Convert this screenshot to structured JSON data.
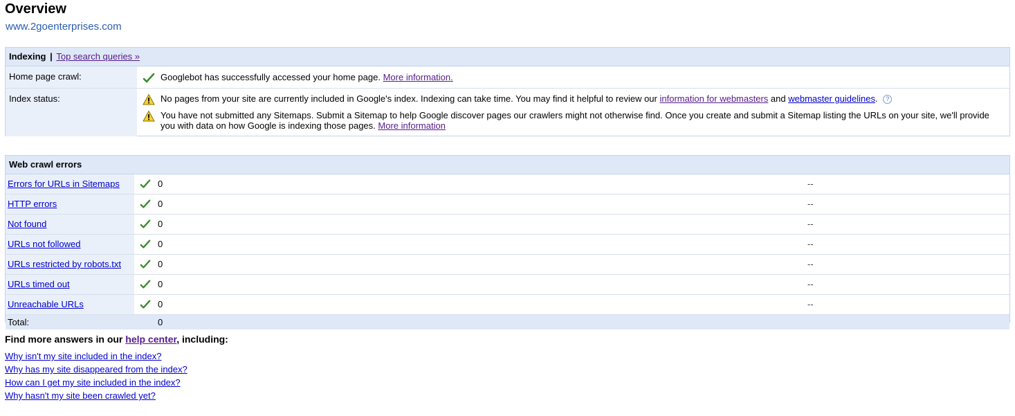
{
  "page": {
    "title": "Overview",
    "site_url": "www.2goenterprises.com"
  },
  "indexing": {
    "header_label": "Indexing",
    "header_separator": "|",
    "top_queries_link": "Top search queries »",
    "home_crawl": {
      "label": "Home page crawl:",
      "message": "Googlebot has successfully accessed your home page.",
      "link": "More information."
    },
    "index_status": {
      "label": "Index status:",
      "msg1_text": "No pages from your site are currently included in Google's index. Indexing can take time. You may find it helpful to review our",
      "msg1_link1": "information for webmasters",
      "msg1_and": "and",
      "msg1_link2": "webmaster guidelines",
      "msg1_period": ".",
      "help_glyph": "?",
      "msg2_text": "You have not submitted any Sitemaps. Submit a Sitemap to help Google discover pages our crawlers might not otherwise find. Once you create and submit a Sitemap listing the URLs on your site, we'll provide you with data on how Google is indexing those pages.",
      "msg2_link": "More information"
    }
  },
  "crawl_errors": {
    "header": "Web crawl errors",
    "rows": [
      {
        "label": "Errors for URLs in Sitemaps",
        "count": "0",
        "detail": "--"
      },
      {
        "label": "HTTP errors",
        "count": "0",
        "detail": "--"
      },
      {
        "label": "Not found",
        "count": "0",
        "detail": "--"
      },
      {
        "label": "URLs not followed",
        "count": "0",
        "detail": "--"
      },
      {
        "label": "URLs restricted by robots.txt",
        "count": "0",
        "detail": "--"
      },
      {
        "label": "URLs timed out",
        "count": "0",
        "detail": "--"
      },
      {
        "label": "Unreachable URLs",
        "count": "0",
        "detail": "--"
      }
    ],
    "total_label": "Total:",
    "total_count": "0"
  },
  "help": {
    "prefix": "Find more answers in our",
    "link": "help center",
    "suffix": ", including:",
    "questions": [
      "Why isn't my site included in the index?",
      "Why has my site disappeared from the index?",
      "How can I get my site included in the index?",
      "Why hasn't my site been crawled yet?"
    ]
  },
  "colors": {
    "header_bg": "#dfe8f7",
    "label_bg": "#eaf0fa",
    "border": "#c3d4ec",
    "link": "#0000cc",
    "visited_link": "#551a8b",
    "check_green": "#3a8a2c",
    "warning_yellow": "#f3d23a"
  },
  "icons": {
    "success": "checkmark-icon",
    "warning": "warning-icon",
    "help": "help-icon"
  }
}
